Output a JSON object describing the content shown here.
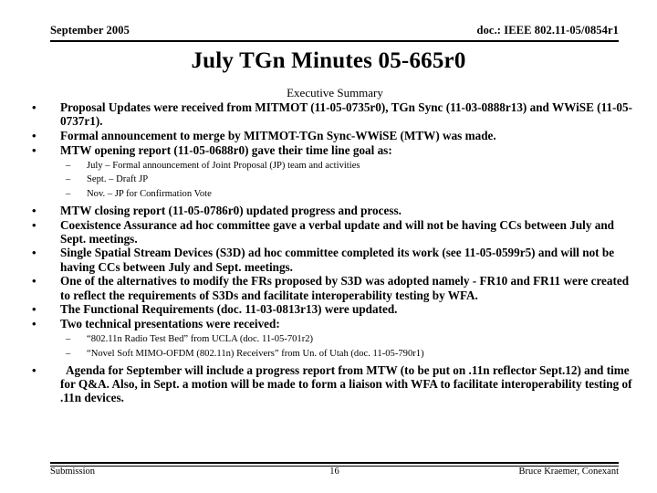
{
  "header": {
    "left": "September 2005",
    "right": "doc.: IEEE 802.11-05/0854r1"
  },
  "title": "July TGn Minutes 05-665r0",
  "content": {
    "section_heading": "Executive Summary",
    "bullet_marker": "•",
    "subbullet_marker": "–",
    "bullets": [
      {
        "text": "Proposal Updates were received from MITMOT (11-05-0735r0), TGn Sync (11-03-0888r13) and WWiSE (11-05-0737r1)."
      },
      {
        "text": "Formal announcement to merge by MITMOT-TGn Sync-WWiSE (MTW) was made."
      },
      {
        "text": "MTW opening report (11-05-0688r0) gave their time line goal as:",
        "subbullets": [
          "July – Formal announcement of Joint Proposal (JP) team and activities",
          "Sept. – Draft JP",
          "Nov. – JP for Confirmation Vote"
        ]
      },
      {
        "text": "MTW closing report (11-05-0786r0) updated progress and process."
      },
      {
        "text": "Coexistence Assurance ad hoc committee gave a verbal update and will not be having CCs between July and Sept. meetings."
      },
      {
        "text": "Single Spatial Stream Devices (S3D) ad hoc committee completed its work (see 11-05-0599r5) and will not be having CCs between July and Sept. meetings."
      },
      {
        "text": "One of the alternatives to modify the FRs proposed by S3D was adopted namely -  FR10 and FR11 were created to reflect the requirements of S3Ds and facilitate interoperability testing by WFA."
      },
      {
        "text": "The Functional Requirements (doc. 11-03-0813r13) were updated."
      },
      {
        "text": "Two technical presentations were received:",
        "subbullets": [
          "“802.11n Radio Test Bed” from UCLA (doc. 11-05-701r2)",
          "“Novel Soft MIMO-OFDM (802.11n) Receivers” from Un. of Utah (doc. 11-05-790r1)"
        ]
      },
      {
        "text": " Agenda for September will include a progress report from MTW (to be put on .11n reflector Sept.12) and time for Q&A. Also, in Sept. a motion will be made to form a liaison with WFA to facilitate interoperability testing of .11n devices."
      }
    ]
  },
  "footer": {
    "left": "Submission",
    "page_number": "16",
    "right": "Bruce Kraemer, Conexant"
  }
}
